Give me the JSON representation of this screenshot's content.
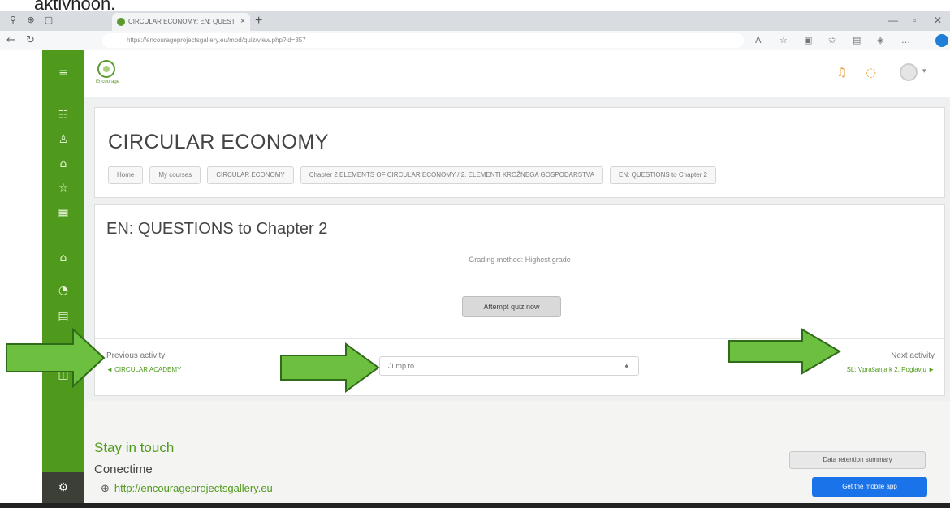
{
  "caption": "aktivnoon.",
  "browser": {
    "tab_title": "CIRCULAR ECONOMY: EN: QUEST",
    "tab_close": "×",
    "new_tab": "+",
    "url": "https://encourageprojectsgallery.eu/mod/quiz/view.php?id=357"
  },
  "header": {
    "logo_sub": "Encourage"
  },
  "page": {
    "title": "CIRCULAR ECONOMY",
    "breadcrumbs": [
      "Home",
      "My courses",
      "CIRCULAR ECONOMY",
      "Chapter 2 ELEMENTS OF CIRCULAR ECONOMY / 2. ELEMENTI KROŽNEGA GOSPODARSTVA",
      "EN: QUESTIONS to Chapter 2"
    ]
  },
  "quiz": {
    "title": "EN: QUESTIONS to Chapter 2",
    "grading": "Grading method: Highest grade",
    "attempt_button": "Attempt quiz now",
    "prev_label": "Previous activity",
    "prev_link": "◄ CIRCULAR ACADEMY",
    "jump_placeholder": "Jump to...",
    "jump_caret": "♦",
    "next_label": "Next activity",
    "next_link": "SL: Vprašanja k 2. Poglavju ►"
  },
  "footer": {
    "stay": "Stay in touch",
    "conect": "Conectime",
    "site": "http://encourageprojectsgallery.eu",
    "data_summary": "Data retention summary",
    "mobile_app": "Get the mobile app"
  },
  "colors": {
    "brand_green": "#4f9a1c",
    "arrow_fill": "#6cbf3f",
    "arrow_stroke": "#2f6b19",
    "mobile_button": "#1a73e8"
  }
}
